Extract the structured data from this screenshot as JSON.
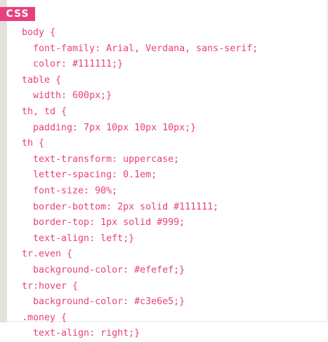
{
  "label": "CSS",
  "accent_color": "#e8407f",
  "code_lines": [
    "body {",
    "  font-family: Arial, Verdana, sans-serif;",
    "  color: #111111;}",
    "table {",
    "  width: 600px;}",
    "th, td {",
    "  padding: 7px 10px 10px 10px;}",
    "th {",
    "  text-transform: uppercase;",
    "  letter-spacing: 0.1em;",
    "  font-size: 90%;",
    "  border-bottom: 2px solid #111111;",
    "  border-top: 1px solid #999;",
    "  text-align: left;}",
    "tr.even {",
    "  background-color: #efefef;}",
    "tr:hover {",
    "  background-color: #c3e6e5;}",
    ".money {",
    "  text-align: right;}"
  ]
}
